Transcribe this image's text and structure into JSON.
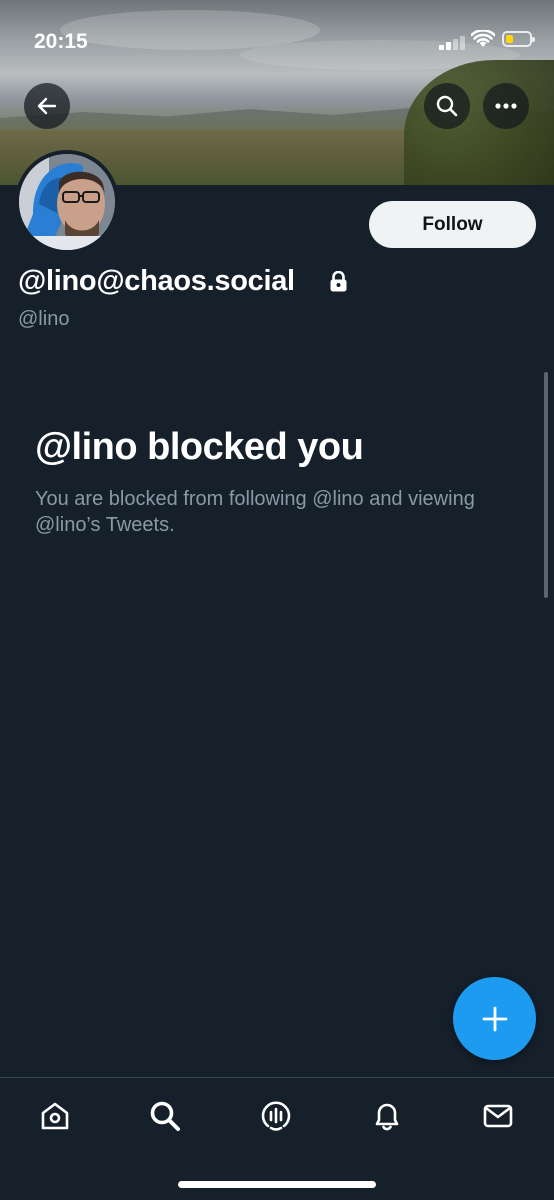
{
  "status_bar": {
    "time": "20:15"
  },
  "profile": {
    "display_name": "@lino@chaos.social",
    "handle": "@lino",
    "follow_label": "Follow",
    "protected_icon": "lock-icon"
  },
  "blocked": {
    "title": "@lino blocked you",
    "message": "You are blocked from following @lino and viewing @lino’s Tweets."
  },
  "header_icons": [
    "back-arrow-icon",
    "search-icon",
    "more-icon"
  ],
  "tabs": [
    {
      "icon": "home-icon"
    },
    {
      "icon": "search-icon"
    },
    {
      "icon": "spaces-icon"
    },
    {
      "icon": "notifications-icon"
    },
    {
      "icon": "messages-icon"
    }
  ],
  "colors": {
    "background": "#15202b",
    "accent": "#1d9bf0",
    "secondary_text": "#8b98a5",
    "follow_button": "#eff3f4",
    "battery": "#ffd60a"
  }
}
